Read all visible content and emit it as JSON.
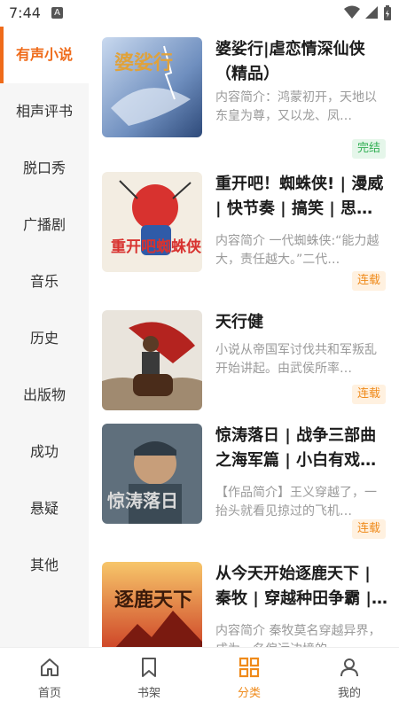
{
  "status": {
    "time": "7:44",
    "notif_letter": "A"
  },
  "sidebar": {
    "items": [
      {
        "label": "有声小说",
        "active": true
      },
      {
        "label": "相声评书"
      },
      {
        "label": "脱口秀"
      },
      {
        "label": "广播剧"
      },
      {
        "label": "音乐"
      },
      {
        "label": "历史"
      },
      {
        "label": "出版物"
      },
      {
        "label": "成功"
      },
      {
        "label": "悬疑"
      },
      {
        "label": "其他"
      }
    ]
  },
  "books": [
    {
      "title": "婆娑行|虐恋情深仙侠（精品）",
      "desc": "内容简介：鸿蒙初开，天地以东皇为尊，又以龙、凤…",
      "status": "完结",
      "cover_text": "婆娑行"
    },
    {
      "title": "重开吧！蜘蛛侠! | 漫威 | 快节奏 | 搞笑 | 思想…",
      "desc": "内容简介 一代蜘蛛侠:“能力越大，责任越大。”二代…",
      "status": "连载",
      "cover_text": "重开吧蜘蛛侠"
    },
    {
      "title": "天行健",
      "desc": "小说从帝国军讨伐共和军叛乱开始讲起。由武侯所率…",
      "status": "连载",
      "cover_text": ""
    },
    {
      "title": "惊涛落日 | 战争三部曲之海军篇 | 小白有戏…",
      "desc": "【作品简介】王义穿越了，一抬头就看见掠过的飞机…",
      "status": "连载",
      "cover_text": "惊涛落日"
    },
    {
      "title": "从今天开始逐鹿天下 | 秦牧 | 穿越种田争霸 | …",
      "desc": "内容简介 秦牧莫名穿越异界，成为一名偏远边境的…",
      "status": "",
      "cover_text": "逐鹿天下"
    }
  ],
  "bottom_nav": {
    "items": [
      {
        "label": "首页",
        "icon": "home-icon"
      },
      {
        "label": "书架",
        "icon": "bookmark-icon"
      },
      {
        "label": "分类",
        "icon": "category-grid-icon",
        "active": true
      },
      {
        "label": "我的",
        "icon": "person-icon"
      }
    ]
  },
  "colors": {
    "accent": "#ef6b1a",
    "done_green": "#2fae52",
    "ongoing_orange": "#ef8a1a"
  }
}
